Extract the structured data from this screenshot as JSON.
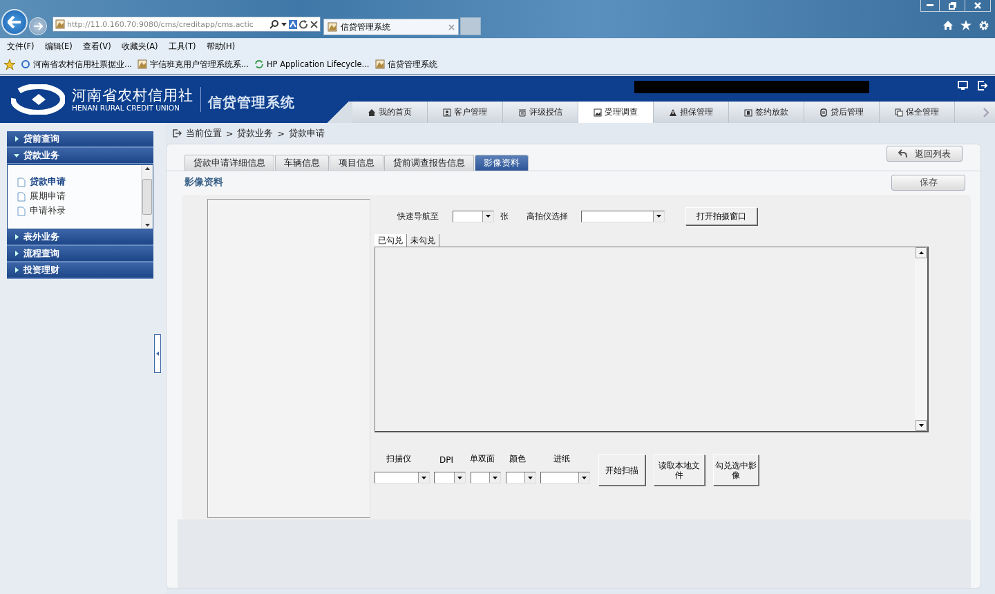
{
  "browser": {
    "address": "http://11.0.160.70:9080/cms/creditapp/cms.actic",
    "tabs": [
      {
        "label": "信贷管理系统",
        "selected": true
      }
    ],
    "menu": [
      "文件(F)",
      "编辑(E)",
      "查看(V)",
      "收藏夹(A)",
      "工具(T)",
      "帮助(H)"
    ],
    "favorites": [
      "河南省农村信用社票据业...",
      "宇信班克用户管理系统系...",
      "HP Application Lifecycle...",
      "信贷管理系统"
    ]
  },
  "header": {
    "org_name": "河南省农村信用社",
    "org_name_en": "HENAN RURAL CREDIT UNION",
    "system_name": "信贷管理系统",
    "nav": [
      {
        "label": "我的首页",
        "selected": false
      },
      {
        "label": "客户管理",
        "selected": false
      },
      {
        "label": "评级授信",
        "selected": false
      },
      {
        "label": "受理调查",
        "selected": true
      },
      {
        "label": "担保管理",
        "selected": false
      },
      {
        "label": "签约放款",
        "selected": false
      },
      {
        "label": "贷后管理",
        "selected": false
      },
      {
        "label": "保全管理",
        "selected": false
      }
    ]
  },
  "sidebar": [
    {
      "label": "贷前查询",
      "expanded": false
    },
    {
      "label": "贷款业务",
      "expanded": true,
      "children": [
        {
          "label": "贷款申请",
          "selected": true
        },
        {
          "label": "展期申请",
          "selected": false
        },
        {
          "label": "申请补录",
          "selected": false
        }
      ]
    },
    {
      "label": "表外业务",
      "expanded": false
    },
    {
      "label": "流程查询",
      "expanded": false
    },
    {
      "label": "投资理财",
      "expanded": false
    }
  ],
  "breadcrumb": {
    "prefix": "当前位置",
    "separator": ">",
    "items": [
      "贷款业务",
      "贷款申请"
    ]
  },
  "tabs": [
    {
      "label": "贷款申请详细信息",
      "selected": false
    },
    {
      "label": "车辆信息",
      "selected": false
    },
    {
      "label": "项目信息",
      "selected": false
    },
    {
      "label": "贷前调查报告信息",
      "selected": false
    },
    {
      "label": "影像资料",
      "selected": true
    }
  ],
  "back_button": "返回列表",
  "section_title": "影像资料",
  "save_button": "保存",
  "imaging": {
    "nav_label": "快速导航至",
    "nav_unit": "张",
    "camera_label": "高拍仪选择",
    "open_camera_button": "打开拍摄窗口",
    "check_tabs": [
      {
        "label": "已勾兑",
        "selected": true
      },
      {
        "label": "未勾兑",
        "selected": false
      }
    ],
    "scan_fields": [
      "扫描仪",
      "DPI",
      "单双面",
      "颜色",
      "进纸"
    ],
    "scan_buttons": [
      "开始扫描",
      "读取本地文件",
      "勾兑选中影像"
    ]
  }
}
